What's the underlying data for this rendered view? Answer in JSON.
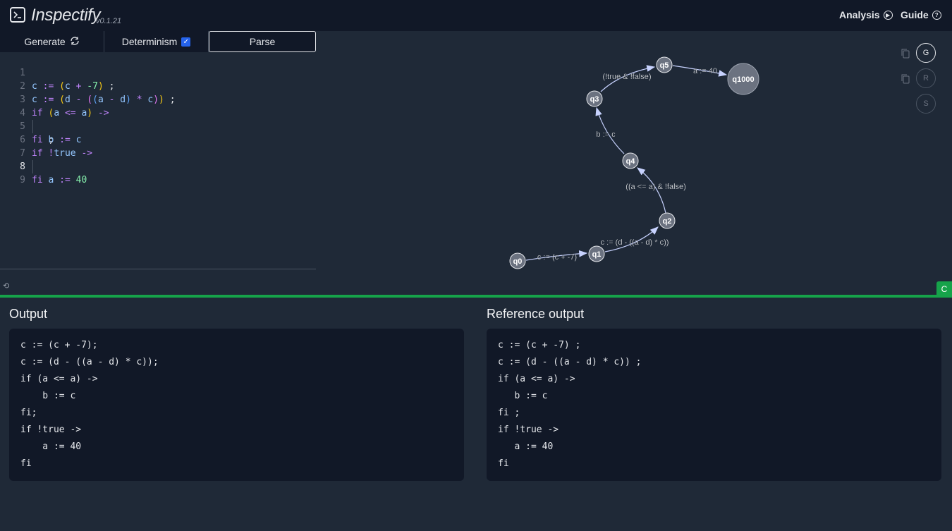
{
  "header": {
    "title": "Inspectify",
    "version": "v0.1.21",
    "nav": [
      {
        "label": "Analysis",
        "icon": "play-circle-icon"
      },
      {
        "label": "Guide",
        "icon": "help-circle-icon"
      }
    ]
  },
  "toolbar": {
    "generate_label": "Generate",
    "determinism_label": "Determinism",
    "determinism_checked": true,
    "parse_label": "Parse"
  },
  "editor": {
    "line_numbers": [
      "1",
      "2",
      "3",
      "4",
      "5",
      "6",
      "7",
      "8",
      "9"
    ],
    "active_line": 8
  },
  "graph": {
    "nodes": [
      "q0",
      "q1",
      "q2",
      "q4",
      "q3",
      "q5",
      "q1000"
    ],
    "edges": [
      {
        "from": "q0",
        "to": "q1",
        "label": "c := (c + -7)"
      },
      {
        "from": "q1",
        "to": "q2",
        "label": "c := (d - ((a - d) * c))"
      },
      {
        "from": "q2",
        "to": "q4",
        "label": "((a <= a) & !false)"
      },
      {
        "from": "q4",
        "to": "q3",
        "label": "b := c"
      },
      {
        "from": "q3",
        "to": "q5",
        "label": "(!true & !false)"
      },
      {
        "from": "q5",
        "to": "q1000",
        "label": "a := 40"
      }
    ],
    "buttons": [
      "G",
      "R",
      "S"
    ]
  },
  "status": {
    "badge": "C"
  },
  "output": {
    "title": "Output",
    "lines": [
      "c := (c + -7);",
      "c := (d - ((a - d) * c));",
      "if (a <= a) ->",
      "    b := c",
      "fi;",
      "if !true ->",
      "    a := 40",
      "fi"
    ]
  },
  "reference": {
    "title": "Reference output",
    "lines": [
      "c := (c + -7) ;",
      "c := (d - ((a - d) * c)) ;",
      "if (a <= a) ->",
      "   b := c",
      "fi ;",
      "if !true ->",
      "   a := 40",
      "fi"
    ]
  }
}
